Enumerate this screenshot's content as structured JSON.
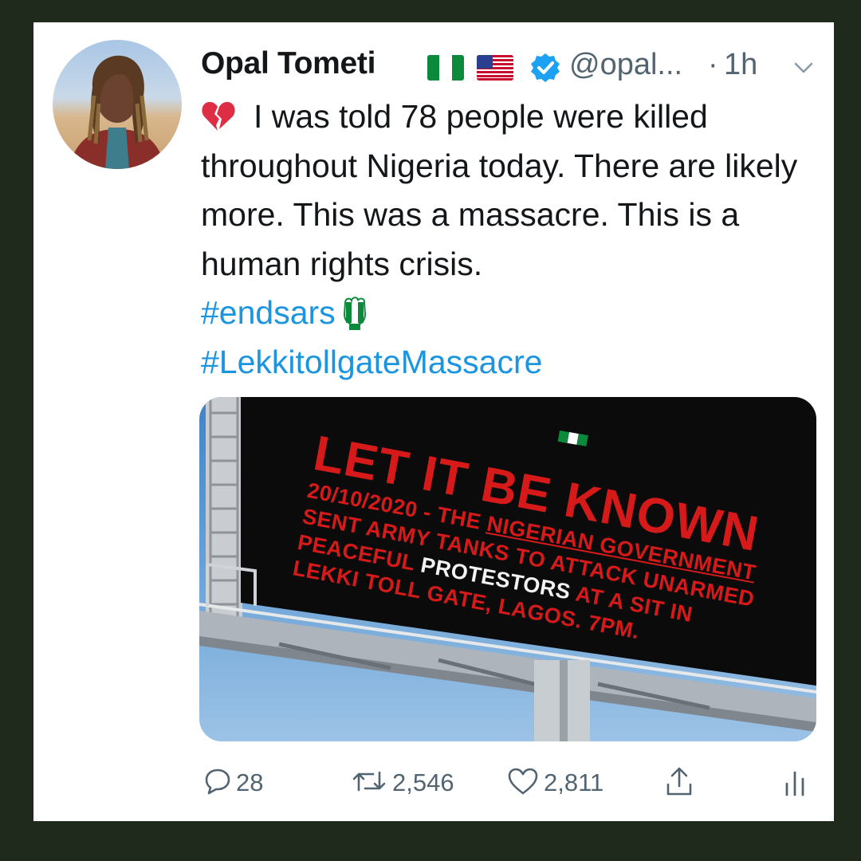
{
  "tweet": {
    "author_name": "Opal Tometi",
    "handle": "@opal...",
    "separator": "·",
    "time": "1h",
    "text_lines": [
      "I was told 78 people were killed throughout Nigeria today. There are likely more. This was a massacre. This is a human rights crisis."
    ],
    "hashtags": [
      "#endsars",
      "#LekkitollgateMassacre"
    ]
  },
  "media": {
    "billboard": {
      "headline": "LET IT BE KNOWN",
      "line1_a": "20/10/2020 - THE ",
      "line1_b": "NIGERIAN GOVERNMENT",
      "line2": "SENT ARMY TANKS TO ATTACK UNARMED",
      "line3_a": "PEACEFUL ",
      "line3_b": "PROTESTORS",
      "line3_c": " AT A SIT IN",
      "line4": "LEKKI TOLL GATE, LAGOS. 7PM."
    }
  },
  "actions": {
    "replies": "28",
    "retweets": "2,546",
    "likes": "2,811"
  },
  "colors": {
    "frame": "#1f2a1d",
    "link": "#1b95e0",
    "muted": "#536471",
    "verified": "#1da1f2",
    "billboard_red": "#d61a1a"
  },
  "icons": [
    "broken-heart-icon",
    "raised-fist-icon",
    "verified-badge-icon",
    "chevron-down-icon",
    "reply-icon",
    "retweet-icon",
    "like-icon",
    "share-icon",
    "analytics-icon"
  ]
}
